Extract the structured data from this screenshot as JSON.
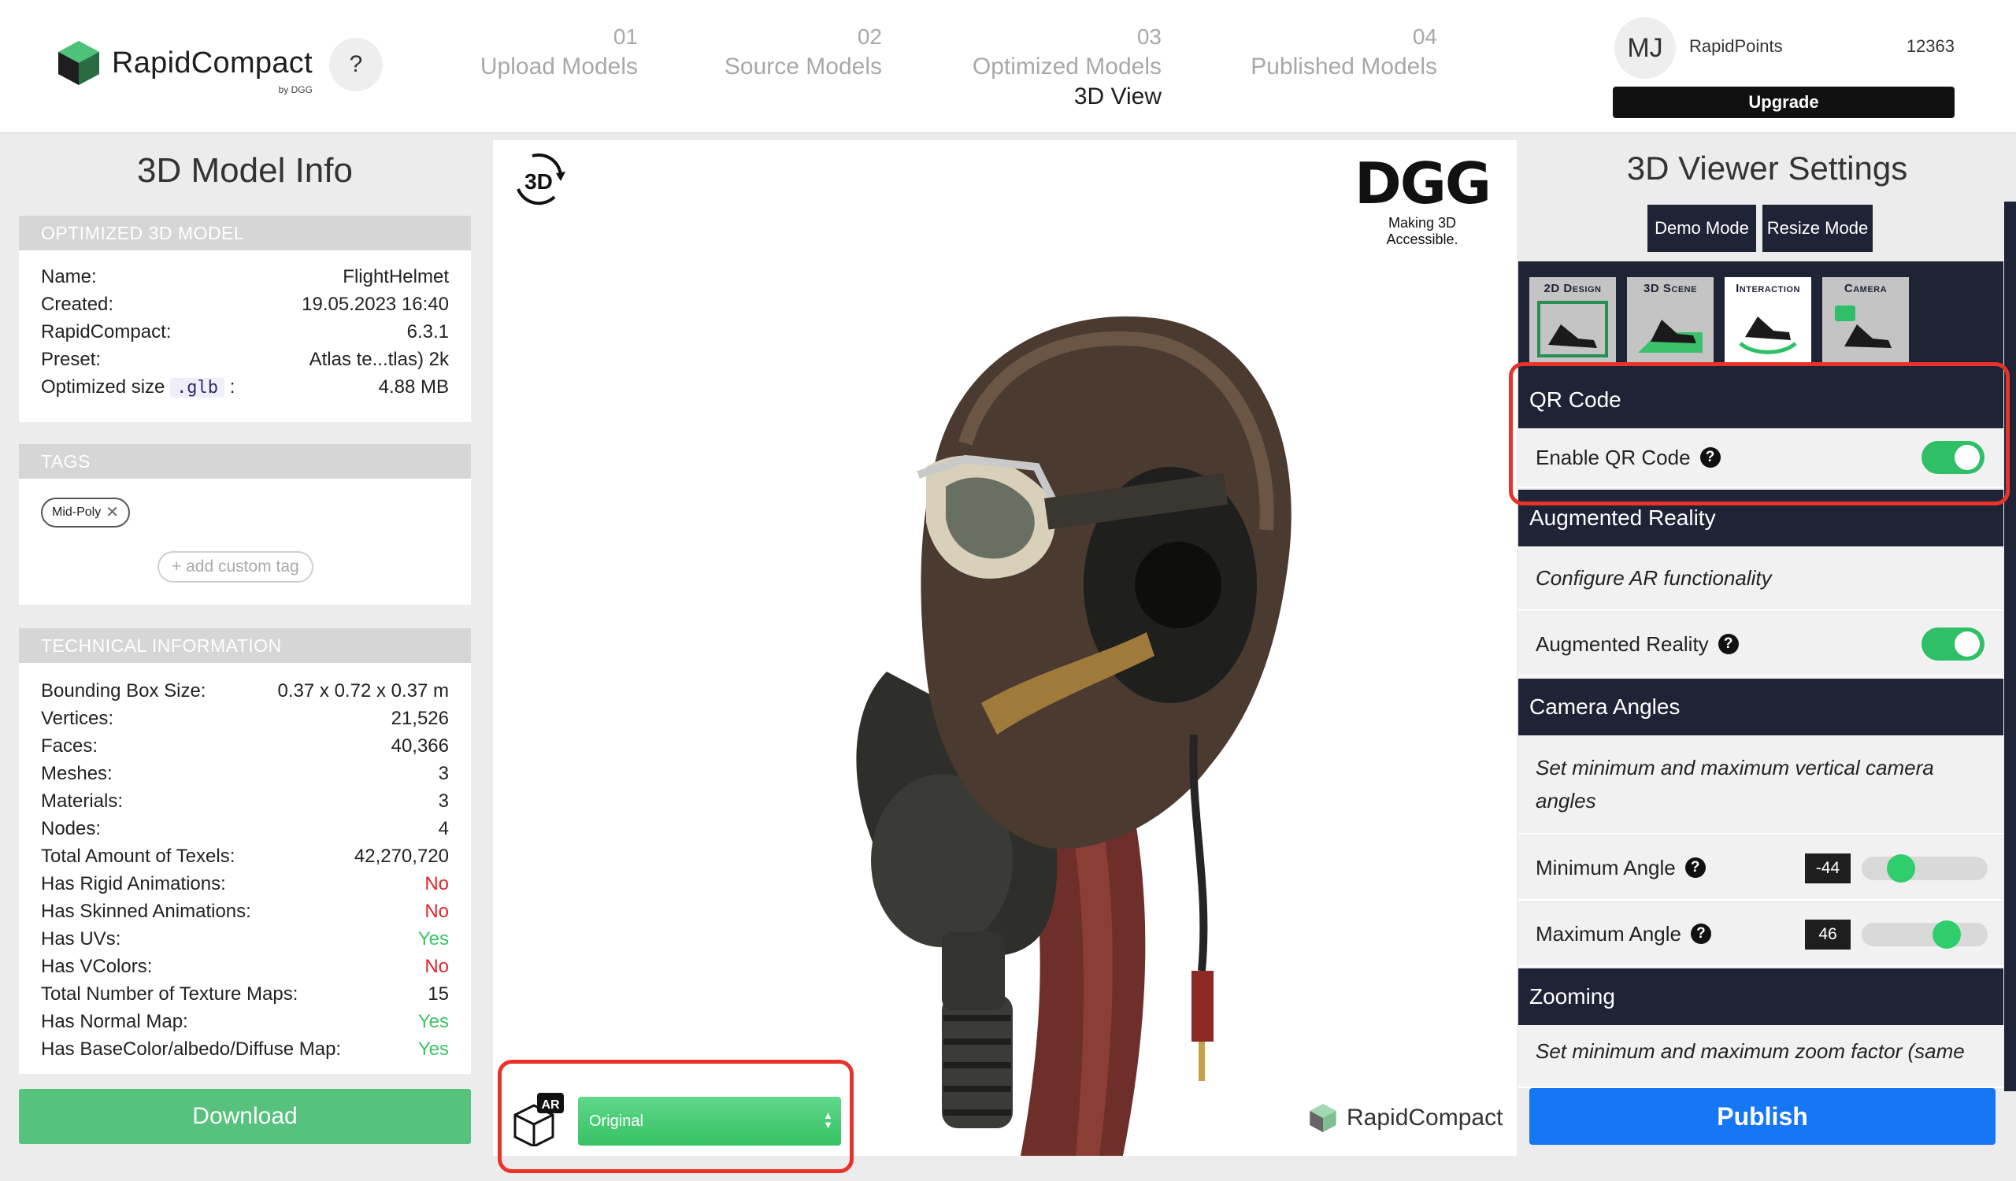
{
  "app": {
    "name": "RapidCompact",
    "by": "by DGG",
    "help": "?"
  },
  "steps": [
    {
      "num": "01",
      "label": "Upload Models",
      "sub": ""
    },
    {
      "num": "02",
      "label": "Source Models",
      "sub": ""
    },
    {
      "num": "03",
      "label": "Optimized Models",
      "sub": "3D View"
    },
    {
      "num": "04",
      "label": "Published Models",
      "sub": ""
    }
  ],
  "user": {
    "initials": "MJ",
    "points_label": "RapidPoints",
    "points": "12363",
    "upgrade": "Upgrade"
  },
  "left": {
    "title": "3D Model Info",
    "optimized": {
      "header": "OPTIMIZED 3D MODEL",
      "rows": [
        {
          "k": "Name:",
          "v": "FlightHelmet"
        },
        {
          "k": "Created:",
          "v": "19.05.2023 16:40"
        },
        {
          "k": "RapidCompact:",
          "v": "6.3.1"
        },
        {
          "k": "Preset:",
          "v": "Atlas te...tlas) 2k"
        }
      ],
      "size_label": "Optimized size",
      "size_ext": ".glb",
      "size_colon": ":",
      "size_value": "4.88 MB"
    },
    "tags": {
      "header": "TAGS",
      "chip": "Mid-Poly",
      "chip_remove": "✕",
      "add": "+  add custom tag"
    },
    "technical": {
      "header": "TECHNICAL INFORMATION",
      "rows": [
        {
          "k": "Bounding Box Size:",
          "v": "0.37 x 0.72 x 0.37 m",
          "s": ""
        },
        {
          "k": "Vertices:",
          "v": "21,526",
          "s": ""
        },
        {
          "k": "Faces:",
          "v": "40,366",
          "s": ""
        },
        {
          "k": "Meshes:",
          "v": "3",
          "s": ""
        },
        {
          "k": "Materials:",
          "v": "3",
          "s": ""
        },
        {
          "k": "Nodes:",
          "v": "4",
          "s": ""
        },
        {
          "k": "Total Amount of Texels:",
          "v": "42,270,720",
          "s": ""
        },
        {
          "k": "Has Rigid Animations:",
          "v": "No",
          "s": "no"
        },
        {
          "k": "Has Skinned Animations:",
          "v": "No",
          "s": "no"
        },
        {
          "k": "Has UVs:",
          "v": "Yes",
          "s": "yes"
        },
        {
          "k": "Has VColors:",
          "v": "No",
          "s": "no"
        },
        {
          "k": "Total Number of Texture Maps:",
          "v": "15",
          "s": ""
        },
        {
          "k": "Has Normal Map:",
          "v": "Yes",
          "s": "yes"
        },
        {
          "k": "Has BaseColor/albedo/Diffuse Map:",
          "v": "Yes",
          "s": "yes"
        }
      ]
    },
    "download": "Download"
  },
  "viewer": {
    "icon_3d": "3D",
    "dgg_logo": "DGG",
    "dgg_tagline": "Making 3D Accessible.",
    "ar_badge": "AR",
    "variant_selected": "Original",
    "watermark": "RapidCompact"
  },
  "right": {
    "title": "3D Viewer Settings",
    "modes": [
      "Demo Mode",
      "Resize Mode"
    ],
    "tabs": [
      "2D Design",
      "3D Scene",
      "Interaction",
      "Camera"
    ],
    "qr": {
      "header": "QR Code",
      "label": "Enable QR Code",
      "enabled": true
    },
    "ar": {
      "header": "Augmented Reality",
      "desc": "Configure AR functionality",
      "label": "Augmented Reality",
      "enabled": true
    },
    "camera": {
      "header": "Camera Angles",
      "desc": "Set minimum and maximum vertical camera angles",
      "min_label": "Minimum Angle",
      "min_value": "-44",
      "max_label": "Maximum Angle",
      "max_value": "46"
    },
    "zoom": {
      "header": "Zooming",
      "desc": "Set minimum and maximum zoom factor (same"
    },
    "publish": "Publish"
  },
  "colors": {
    "dark_navy": "#1f2336",
    "green": "#2fbf67",
    "publish_blue": "#1677f4",
    "download_green": "#57c27e",
    "highlight_red": "#e9322a"
  },
  "icons": [
    "help-icon",
    "3d-rotate-icon",
    "ar-cube-icon",
    "question-icon",
    "close-icon",
    "plus-icon"
  ]
}
